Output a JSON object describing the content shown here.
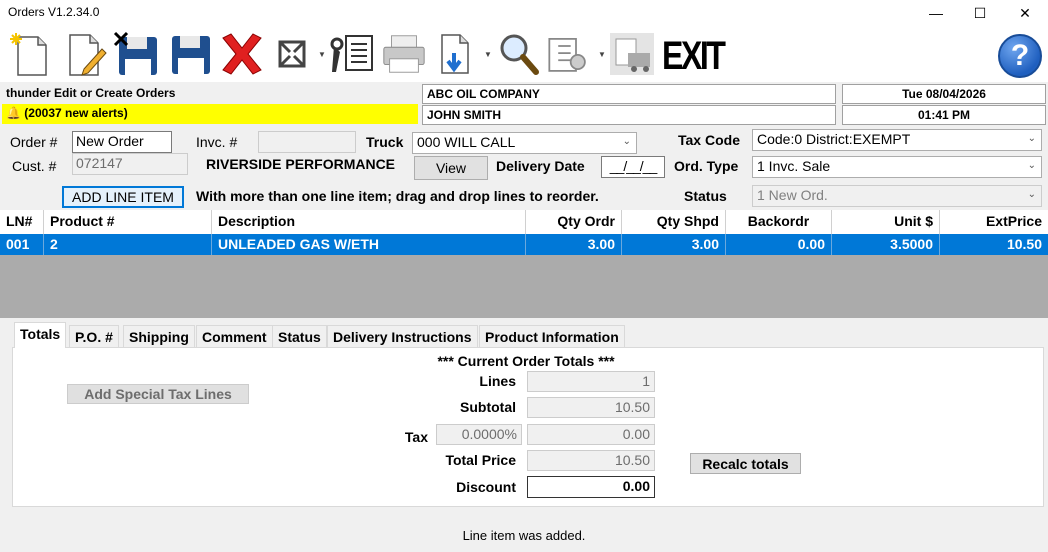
{
  "window": {
    "title": "Orders V1.2.34.0",
    "minimize": "—",
    "maximize": "☐",
    "close": "✕"
  },
  "toolbar": {
    "exit_label": "EXIT",
    "help_label": "?"
  },
  "header": {
    "module_title": "thunder Edit or Create Orders",
    "alerts": "(20037 new alerts)",
    "company": "ABC OIL COMPANY",
    "user": "JOHN SMITH",
    "date": "Tue 08/04/2026",
    "time": "01:41 PM"
  },
  "form": {
    "order_label": "Order #",
    "order_value": "New Order",
    "invc_label": "Invc. #",
    "invc_value": "",
    "truck_label": "Truck",
    "truck_value": "000 WILL CALL",
    "tax_code_label": "Tax Code",
    "tax_code_value": "Code:0 District:EXEMPT",
    "cust_label": "Cust. #",
    "cust_value": "072147",
    "cust_name": "RIVERSIDE PERFORMANCE",
    "view_button": "View",
    "delivery_date_label": "Delivery Date",
    "delivery_date_value": "__/__/__",
    "ord_type_label": "Ord. Type",
    "ord_type_value": "1 Invc. Sale",
    "add_line_item_button": "ADD LINE ITEM",
    "reorder_hint": "With more than one line item; drag and drop lines to reorder.",
    "status_label": "Status",
    "status_value": "1 New Ord."
  },
  "grid": {
    "columns": [
      "LN#",
      "Product #",
      "Description",
      "Qty Ordr",
      "Qty Shpd",
      "Backordr",
      "Unit $",
      "ExtPrice"
    ],
    "rows": [
      {
        "ln": "001",
        "product": "2",
        "description": "UNLEADED GAS W/ETH",
        "qty_ordr": "3.00",
        "qty_shpd": "3.00",
        "backordr": "0.00",
        "unit": "3.5000",
        "ext_price": "10.50"
      }
    ]
  },
  "tabs": [
    "Totals",
    "P.O. #",
    "Shipping",
    "Comment",
    "Status",
    "Delivery Instructions",
    "Product Information"
  ],
  "totals": {
    "heading": "*** Current Order Totals ***",
    "add_special_tax_button": "Add Special Tax Lines",
    "lines_label": "Lines",
    "lines_value": "1",
    "subtotal_label": "Subtotal",
    "subtotal_value": "10.50",
    "tax_label": "Tax",
    "tax_rate": "0.0000%",
    "tax_value": "0.00",
    "total_price_label": "Total Price",
    "total_price_value": "10.50",
    "discount_label": "Discount",
    "discount_value": "0.00",
    "recalc_button": "Recalc totals"
  },
  "status_bar": {
    "message": "Line item was added."
  },
  "colors": {
    "selection": "#0078d7",
    "alert_bg": "#ffff00",
    "help_blue": "#1f5fbf"
  }
}
